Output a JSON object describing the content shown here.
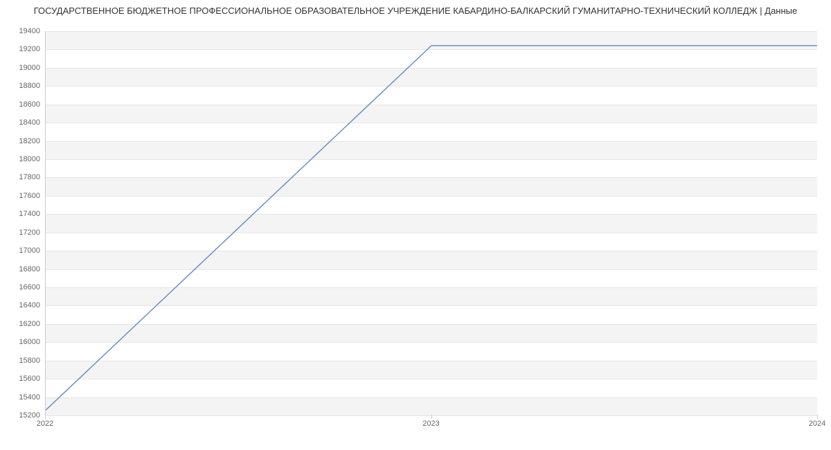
{
  "chart_data": {
    "type": "line",
    "title": "ГОСУДАРСТВЕННОЕ БЮДЖЕТНОЕ ПРОФЕССИОНАЛЬНОЕ ОБРАЗОВАТЕЛЬНОЕ УЧРЕЖДЕНИЕ КАБАРДИНО-БАЛКАРСКИЙ ГУМАНИТАРНО-ТЕХНИЧЕСКИЙ КОЛЛЕДЖ | Данные",
    "x": [
      2022,
      2023,
      2024
    ],
    "values": [
      15250,
      19242,
      19242
    ],
    "xlabel": "",
    "ylabel": "",
    "xlim": [
      2022,
      2024
    ],
    "ylim": [
      15200,
      19400
    ],
    "x_ticks": [
      2022,
      2023,
      2024
    ],
    "y_ticks": [
      15200,
      15400,
      15600,
      15800,
      16000,
      16200,
      16400,
      16600,
      16800,
      17000,
      17200,
      17400,
      17600,
      17800,
      18000,
      18200,
      18400,
      18600,
      18800,
      19000,
      19200,
      19400
    ],
    "line_color": "#6a8fc8",
    "grid": true
  }
}
